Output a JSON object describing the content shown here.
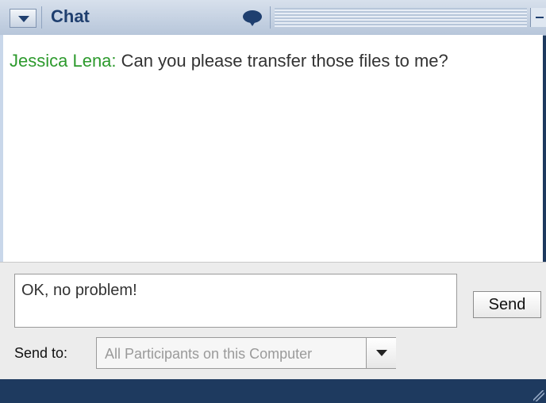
{
  "title": "Chat",
  "icons": {
    "menu": "chevron-down-icon",
    "chat": "speech-bubble-icon",
    "minimize": "minimize-icon"
  },
  "messages": [
    {
      "sender": "Jessica Lena:",
      "text": " Can you please transfer those files to me?",
      "sender_color": "#2d9a2d"
    }
  ],
  "compose": {
    "value": "OK, no problem!"
  },
  "send_button": {
    "label": "Send"
  },
  "send_to": {
    "label": "Send to:",
    "selected": "All Participants on this Computer"
  },
  "colors": {
    "title_bar": "#b7c6da",
    "frame": "#1e3a5f",
    "sender": "#2d9a2d"
  }
}
